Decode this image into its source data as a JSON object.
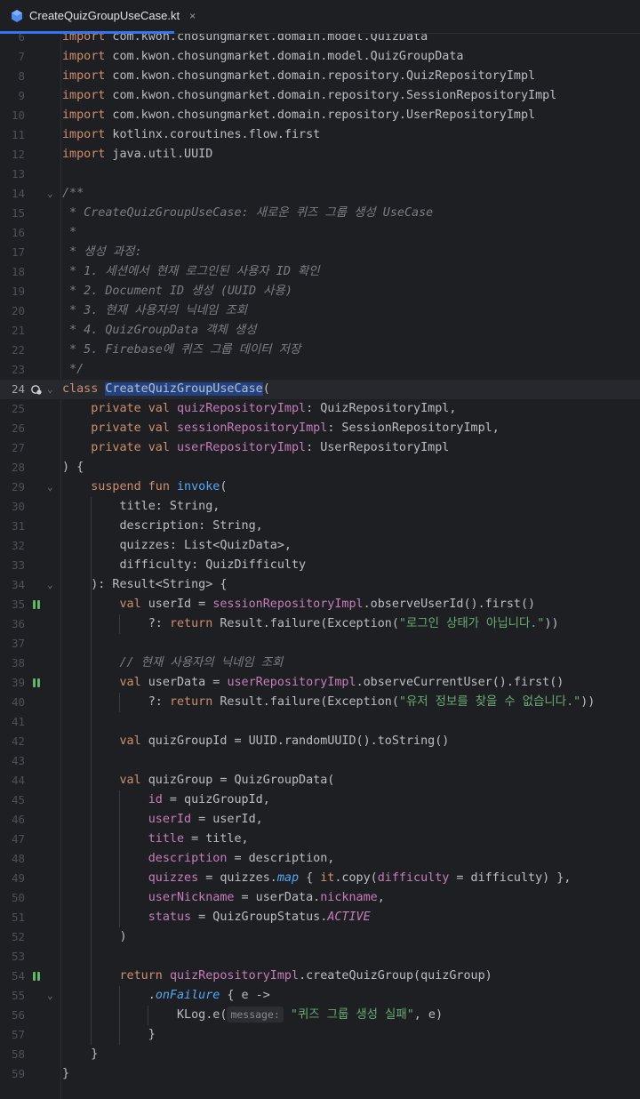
{
  "tab": {
    "filename": "CreateQuizGroupUseCase.kt",
    "close_glyph": "×",
    "icon": "kotlin-file-icon"
  },
  "editor": {
    "lines": [
      {
        "n": "6",
        "text": "import com.kwon.chosungmarket.domain.model.QuizData"
      },
      {
        "n": "7",
        "text": "import com.kwon.chosungmarket.domain.model.QuizGroupData"
      },
      {
        "n": "8",
        "text": "import com.kwon.chosungmarket.domain.repository.QuizRepositoryImpl"
      },
      {
        "n": "9",
        "text": "import com.kwon.chosungmarket.domain.repository.SessionRepositoryImpl"
      },
      {
        "n": "10",
        "text": "import com.kwon.chosungmarket.domain.repository.UserRepositoryImpl"
      },
      {
        "n": "11",
        "text": "import kotlinx.coroutines.flow.first"
      },
      {
        "n": "12",
        "text": "import java.util.UUID"
      },
      {
        "n": "13",
        "text": ""
      },
      {
        "n": "14",
        "text": "/**"
      },
      {
        "n": "15",
        "text": " * CreateQuizGroupUseCase: 새로운 퀴즈 그룹 생성 UseCase"
      },
      {
        "n": "16",
        "text": " *"
      },
      {
        "n": "17",
        "text": " * 생성 과정:"
      },
      {
        "n": "18",
        "text": " * 1. 세션에서 현재 로그인된 사용자 ID 확인"
      },
      {
        "n": "19",
        "text": " * 2. Document ID 생성 (UUID 사용)"
      },
      {
        "n": "20",
        "text": " * 3. 현재 사용자의 닉네임 조회"
      },
      {
        "n": "21",
        "text": " * 4. QuizGroupData 객체 생성"
      },
      {
        "n": "22",
        "text": " * 5. Firebase에 퀴즈 그룹 데이터 저장"
      },
      {
        "n": "23",
        "text": " */"
      },
      {
        "n": "24",
        "text": "class CreateQuizGroupUseCase("
      },
      {
        "n": "25",
        "text": "    private val quizRepositoryImpl: QuizRepositoryImpl,"
      },
      {
        "n": "26",
        "text": "    private val sessionRepositoryImpl: SessionRepositoryImpl,"
      },
      {
        "n": "27",
        "text": "    private val userRepositoryImpl: UserRepositoryImpl"
      },
      {
        "n": "28",
        "text": ") {"
      },
      {
        "n": "29",
        "text": "    suspend fun invoke("
      },
      {
        "n": "30",
        "text": "        title: String,"
      },
      {
        "n": "31",
        "text": "        description: String,"
      },
      {
        "n": "32",
        "text": "        quizzes: List<QuizData>,"
      },
      {
        "n": "33",
        "text": "        difficulty: QuizDifficulty"
      },
      {
        "n": "34",
        "text": "    ): Result<String> {"
      },
      {
        "n": "35",
        "text": "        val userId = sessionRepositoryImpl.observeUserId().first()"
      },
      {
        "n": "36",
        "text": "            ?: return Result.failure(Exception(\"로그인 상태가 아닙니다.\"))"
      },
      {
        "n": "37",
        "text": ""
      },
      {
        "n": "38",
        "text": "        // 현재 사용자의 닉네임 조회"
      },
      {
        "n": "39",
        "text": "        val userData = userRepositoryImpl.observeCurrentUser().first()"
      },
      {
        "n": "40",
        "text": "            ?: return Result.failure(Exception(\"유저 정보를 찾을 수 없습니다.\"))"
      },
      {
        "n": "41",
        "text": ""
      },
      {
        "n": "42",
        "text": "        val quizGroupId = UUID.randomUUID().toString()"
      },
      {
        "n": "43",
        "text": ""
      },
      {
        "n": "44",
        "text": "        val quizGroup = QuizGroupData("
      },
      {
        "n": "45",
        "text": "            id = quizGroupId,"
      },
      {
        "n": "46",
        "text": "            userId = userId,"
      },
      {
        "n": "47",
        "text": "            title = title,"
      },
      {
        "n": "48",
        "text": "            description = description,"
      },
      {
        "n": "49",
        "text": "            quizzes = quizzes.map { it.copy(difficulty = difficulty) },"
      },
      {
        "n": "50",
        "text": "            userNickname = userData.nickname,"
      },
      {
        "n": "51",
        "text": "            status = QuizGroupStatus.ACTIVE"
      },
      {
        "n": "52",
        "text": "        )"
      },
      {
        "n": "53",
        "text": ""
      },
      {
        "n": "54",
        "text": "        return quizRepositoryImpl.createQuizGroup(quizGroup)"
      },
      {
        "n": "55",
        "text": "            .onFailure { e ->"
      },
      {
        "n": "56",
        "text": "                KLog.e(message: \"퀴즈 그룹 생성 실패\", e)"
      },
      {
        "n": "57",
        "text": "            }"
      },
      {
        "n": "58",
        "text": "    }"
      },
      {
        "n": "59",
        "text": "}"
      }
    ],
    "current_line": "24",
    "fold_lines": [
      "14",
      "24",
      "29",
      "34",
      "55"
    ],
    "suspend_marker_lines": [
      "35",
      "39",
      "54"
    ],
    "usage_marker_line": "24",
    "colors": {
      "background": "#1e1f22",
      "keyword": "#cf8e6d",
      "comment": "#7a7e85",
      "string": "#6aab73",
      "function": "#56a8f5",
      "property": "#c77dbb",
      "selection": "#214283",
      "tab_underline": "#3574f0"
    }
  }
}
